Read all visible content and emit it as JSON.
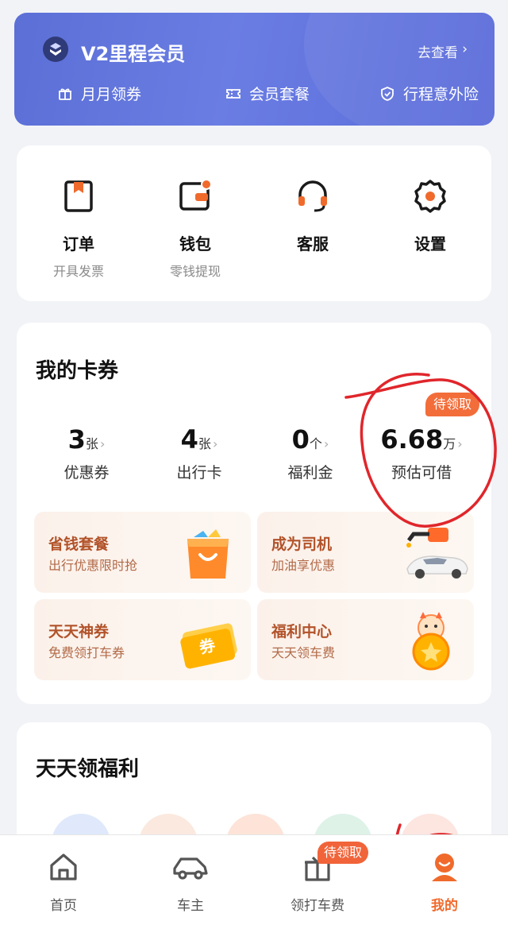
{
  "membership": {
    "title": "V2里程会员",
    "view_more": "去查看",
    "perks": [
      {
        "label": "月月领券",
        "icon": "gift-icon"
      },
      {
        "label": "会员套餐",
        "icon": "ticket-icon"
      },
      {
        "label": "行程意外险",
        "icon": "shield-icon"
      }
    ]
  },
  "quick_actions": [
    {
      "label": "订单",
      "sub": "开具发票",
      "icon": "order-icon"
    },
    {
      "label": "钱包",
      "sub": "零钱提现",
      "icon": "wallet-icon"
    },
    {
      "label": "客服",
      "sub": "",
      "icon": "headset-icon"
    },
    {
      "label": "设置",
      "sub": "",
      "icon": "gear-icon"
    }
  ],
  "coupons": {
    "title": "我的卡券",
    "pending_badge": "待领取",
    "stats": [
      {
        "value": "3",
        "unit": "张",
        "label": "优惠券"
      },
      {
        "value": "4",
        "unit": "张",
        "label": "出行卡"
      },
      {
        "value": "0",
        "unit": "个",
        "label": "福利金"
      },
      {
        "value": "6.68",
        "unit": "万",
        "label": "预估可借"
      }
    ],
    "promos": [
      {
        "title": "省钱套餐",
        "sub": "出行优惠限时抢",
        "icon": "shopping-bag-icon"
      },
      {
        "title": "成为司机",
        "sub": "加油享优惠",
        "icon": "car-fuel-icon"
      },
      {
        "title": "天天神券",
        "sub": "免费领打车券",
        "icon": "coupon-icon",
        "art_text": "券"
      },
      {
        "title": "福利中心",
        "sub": "天天领车费",
        "icon": "coin-mascot-icon"
      }
    ]
  },
  "welfare": {
    "title": "天天领福利"
  },
  "tabbar": {
    "badge": "待领取",
    "tabs": [
      {
        "label": "首页",
        "icon": "home-icon"
      },
      {
        "label": "车主",
        "icon": "car-icon"
      },
      {
        "label": "领打车费",
        "icon": "gift-box-icon"
      },
      {
        "label": "我的",
        "icon": "profile-icon"
      }
    ],
    "active": "我的"
  },
  "colors": {
    "accent": "#f06a2c",
    "vip_banner": "#5f72dc",
    "promo_text": "#b2532a",
    "annotation": "#e0262b"
  }
}
